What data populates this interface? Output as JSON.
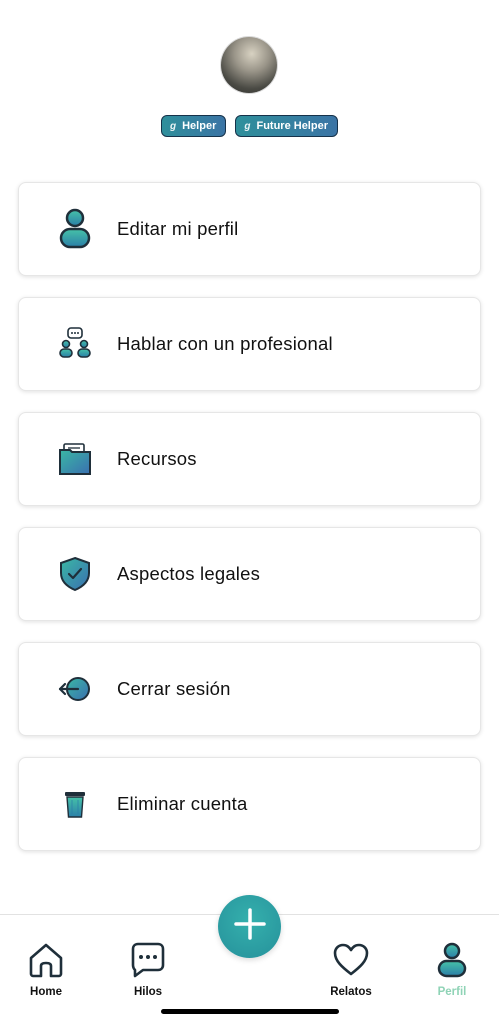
{
  "profile": {
    "badges": [
      {
        "label": "Helper",
        "icon": "g-letter-icon"
      },
      {
        "label": "Future Helper",
        "icon": "g-letter-icon"
      }
    ]
  },
  "menu": {
    "items": [
      {
        "label": "Editar mi perfil",
        "icon": "user-icon"
      },
      {
        "label": "Hablar con un profesional",
        "icon": "professional-chat-icon"
      },
      {
        "label": "Recursos",
        "icon": "folder-icon"
      },
      {
        "label": "Aspectos legales",
        "icon": "shield-check-icon"
      },
      {
        "label": "Cerrar sesión",
        "icon": "logout-icon"
      },
      {
        "label": "Eliminar cuenta",
        "icon": "trash-icon"
      }
    ]
  },
  "tabbar": {
    "tabs": [
      {
        "label": "Home",
        "icon": "home-icon"
      },
      {
        "label": "Hilos",
        "icon": "chat-bubble-icon"
      },
      {
        "label": "Relatos",
        "icon": "heart-icon"
      },
      {
        "label": "Perfil",
        "icon": "user-icon",
        "active": true
      }
    ],
    "fab_icon": "plus-icon"
  },
  "colors": {
    "accent": "#2a9aa0",
    "accent_blue": "#3b74a5",
    "active_tab": "#8fd3b6",
    "icon_stroke": "#1f2f3a"
  }
}
